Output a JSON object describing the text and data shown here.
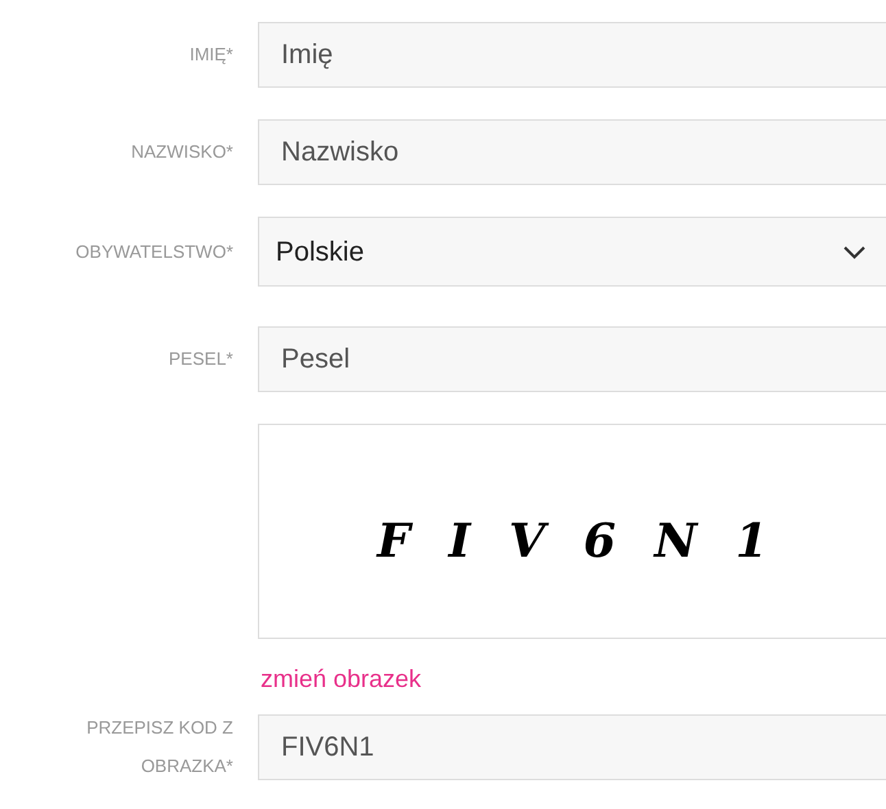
{
  "fields": [
    {
      "kind": "text",
      "label": "IMIĘ*",
      "value": "Imię"
    },
    {
      "kind": "text",
      "label": "NAZWISKO*",
      "value": "Nazwisko"
    },
    {
      "kind": "select",
      "label": "OBYWATELSTWO*",
      "value": "Polskie"
    },
    {
      "kind": "text",
      "label": "PESEL*",
      "value": "Pesel"
    },
    {
      "kind": "captcha",
      "captcha_text": "FIV6N1",
      "link": "zmień obrazek"
    },
    {
      "kind": "text",
      "label": "PRZEPISZ KOD Z OBRAZKA*",
      "value": "FIV6N1"
    }
  ]
}
